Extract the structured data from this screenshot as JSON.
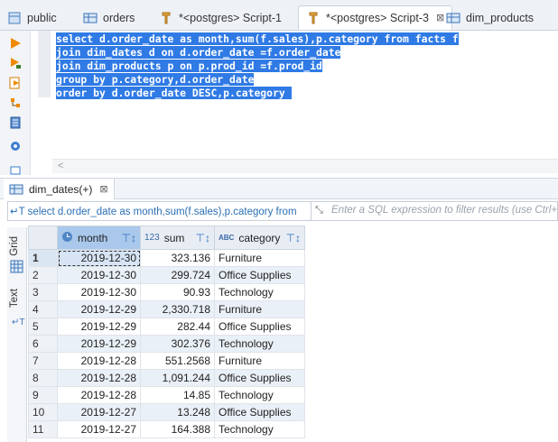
{
  "tabs": [
    {
      "label": "public"
    },
    {
      "label": "orders"
    },
    {
      "label": "*<postgres> Script-1"
    },
    {
      "label": "*<postgres> Script-3",
      "close": "⊠"
    },
    {
      "label": "dim_products"
    }
  ],
  "editor": {
    "lines": [
      "select d.order_date as month,sum(f.sales),p.category from facts f",
      "join dim_dates d on d.order_date =f.order_date",
      "join dim_products p on p.prod_id =f.prod_id",
      "group by p.category,d.order_date",
      "order by d.order_date DESC,p.category "
    ],
    "scroll_arrow": "<"
  },
  "results": {
    "tab_label": "dim_dates(+)",
    "tab_close": "⊠",
    "query_preview": "select d.order_date as month,sum(f.sales),p.category from",
    "filter_placeholder": "Enter a SQL expression to filter results (use Ctrl+",
    "side_tabs": {
      "grid": "Grid",
      "text": "Text"
    },
    "columns": [
      {
        "label": "month",
        "icon": "clock-icon"
      },
      {
        "label": "sum",
        "icon_text": "123"
      },
      {
        "label": "category",
        "icon_text": "ABC"
      }
    ],
    "rows": [
      {
        "n": "1",
        "month": "2019-12-30",
        "sum": "323.136",
        "category": "Furniture"
      },
      {
        "n": "2",
        "month": "2019-12-30",
        "sum": "299.724",
        "category": "Office Supplies"
      },
      {
        "n": "3",
        "month": "2019-12-30",
        "sum": "90.93",
        "category": "Technology"
      },
      {
        "n": "4",
        "month": "2019-12-29",
        "sum": "2,330.718",
        "category": "Furniture"
      },
      {
        "n": "5",
        "month": "2019-12-29",
        "sum": "282.44",
        "category": "Office Supplies"
      },
      {
        "n": "6",
        "month": "2019-12-29",
        "sum": "302.376",
        "category": "Technology"
      },
      {
        "n": "7",
        "month": "2019-12-28",
        "sum": "551.2568",
        "category": "Furniture"
      },
      {
        "n": "8",
        "month": "2019-12-28",
        "sum": "1,091.244",
        "category": "Office Supplies"
      },
      {
        "n": "9",
        "month": "2019-12-28",
        "sum": "14.85",
        "category": "Technology"
      },
      {
        "n": "10",
        "month": "2019-12-27",
        "sum": "13.248",
        "category": "Office Supplies"
      },
      {
        "n": "11",
        "month": "2019-12-27",
        "sum": "164.388",
        "category": "Technology"
      }
    ]
  },
  "colors": {
    "selection": "#2f7ae5",
    "accent": "#2f72c2"
  }
}
